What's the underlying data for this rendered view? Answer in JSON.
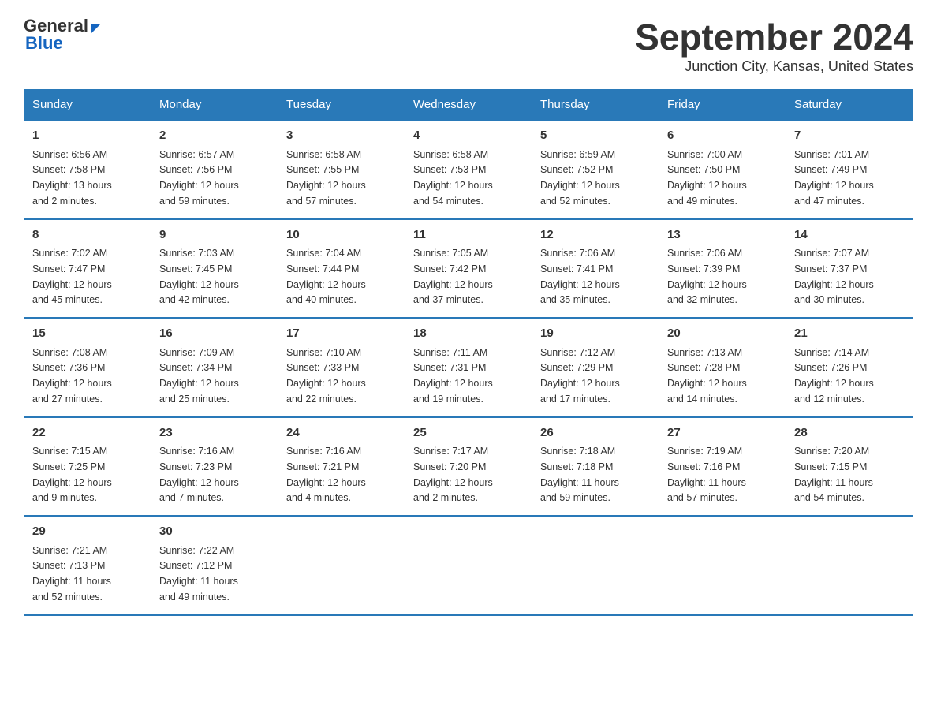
{
  "header": {
    "logo_general": "General",
    "logo_blue": "Blue",
    "title": "September 2024",
    "subtitle": "Junction City, Kansas, United States"
  },
  "weekdays": [
    "Sunday",
    "Monday",
    "Tuesday",
    "Wednesday",
    "Thursday",
    "Friday",
    "Saturday"
  ],
  "weeks": [
    [
      {
        "day": "1",
        "sunrise": "6:56 AM",
        "sunset": "7:58 PM",
        "daylight": "13 hours and 2 minutes."
      },
      {
        "day": "2",
        "sunrise": "6:57 AM",
        "sunset": "7:56 PM",
        "daylight": "12 hours and 59 minutes."
      },
      {
        "day": "3",
        "sunrise": "6:58 AM",
        "sunset": "7:55 PM",
        "daylight": "12 hours and 57 minutes."
      },
      {
        "day": "4",
        "sunrise": "6:58 AM",
        "sunset": "7:53 PM",
        "daylight": "12 hours and 54 minutes."
      },
      {
        "day": "5",
        "sunrise": "6:59 AM",
        "sunset": "7:52 PM",
        "daylight": "12 hours and 52 minutes."
      },
      {
        "day": "6",
        "sunrise": "7:00 AM",
        "sunset": "7:50 PM",
        "daylight": "12 hours and 49 minutes."
      },
      {
        "day": "7",
        "sunrise": "7:01 AM",
        "sunset": "7:49 PM",
        "daylight": "12 hours and 47 minutes."
      }
    ],
    [
      {
        "day": "8",
        "sunrise": "7:02 AM",
        "sunset": "7:47 PM",
        "daylight": "12 hours and 45 minutes."
      },
      {
        "day": "9",
        "sunrise": "7:03 AM",
        "sunset": "7:45 PM",
        "daylight": "12 hours and 42 minutes."
      },
      {
        "day": "10",
        "sunrise": "7:04 AM",
        "sunset": "7:44 PM",
        "daylight": "12 hours and 40 minutes."
      },
      {
        "day": "11",
        "sunrise": "7:05 AM",
        "sunset": "7:42 PM",
        "daylight": "12 hours and 37 minutes."
      },
      {
        "day": "12",
        "sunrise": "7:06 AM",
        "sunset": "7:41 PM",
        "daylight": "12 hours and 35 minutes."
      },
      {
        "day": "13",
        "sunrise": "7:06 AM",
        "sunset": "7:39 PM",
        "daylight": "12 hours and 32 minutes."
      },
      {
        "day": "14",
        "sunrise": "7:07 AM",
        "sunset": "7:37 PM",
        "daylight": "12 hours and 30 minutes."
      }
    ],
    [
      {
        "day": "15",
        "sunrise": "7:08 AM",
        "sunset": "7:36 PM",
        "daylight": "12 hours and 27 minutes."
      },
      {
        "day": "16",
        "sunrise": "7:09 AM",
        "sunset": "7:34 PM",
        "daylight": "12 hours and 25 minutes."
      },
      {
        "day": "17",
        "sunrise": "7:10 AM",
        "sunset": "7:33 PM",
        "daylight": "12 hours and 22 minutes."
      },
      {
        "day": "18",
        "sunrise": "7:11 AM",
        "sunset": "7:31 PM",
        "daylight": "12 hours and 19 minutes."
      },
      {
        "day": "19",
        "sunrise": "7:12 AM",
        "sunset": "7:29 PM",
        "daylight": "12 hours and 17 minutes."
      },
      {
        "day": "20",
        "sunrise": "7:13 AM",
        "sunset": "7:28 PM",
        "daylight": "12 hours and 14 minutes."
      },
      {
        "day": "21",
        "sunrise": "7:14 AM",
        "sunset": "7:26 PM",
        "daylight": "12 hours and 12 minutes."
      }
    ],
    [
      {
        "day": "22",
        "sunrise": "7:15 AM",
        "sunset": "7:25 PM",
        "daylight": "12 hours and 9 minutes."
      },
      {
        "day": "23",
        "sunrise": "7:16 AM",
        "sunset": "7:23 PM",
        "daylight": "12 hours and 7 minutes."
      },
      {
        "day": "24",
        "sunrise": "7:16 AM",
        "sunset": "7:21 PM",
        "daylight": "12 hours and 4 minutes."
      },
      {
        "day": "25",
        "sunrise": "7:17 AM",
        "sunset": "7:20 PM",
        "daylight": "12 hours and 2 minutes."
      },
      {
        "day": "26",
        "sunrise": "7:18 AM",
        "sunset": "7:18 PM",
        "daylight": "11 hours and 59 minutes."
      },
      {
        "day": "27",
        "sunrise": "7:19 AM",
        "sunset": "7:16 PM",
        "daylight": "11 hours and 57 minutes."
      },
      {
        "day": "28",
        "sunrise": "7:20 AM",
        "sunset": "7:15 PM",
        "daylight": "11 hours and 54 minutes."
      }
    ],
    [
      {
        "day": "29",
        "sunrise": "7:21 AM",
        "sunset": "7:13 PM",
        "daylight": "11 hours and 52 minutes."
      },
      {
        "day": "30",
        "sunrise": "7:22 AM",
        "sunset": "7:12 PM",
        "daylight": "11 hours and 49 minutes."
      },
      null,
      null,
      null,
      null,
      null
    ]
  ],
  "labels": {
    "sunrise": "Sunrise:",
    "sunset": "Sunset:",
    "daylight": "Daylight:"
  }
}
